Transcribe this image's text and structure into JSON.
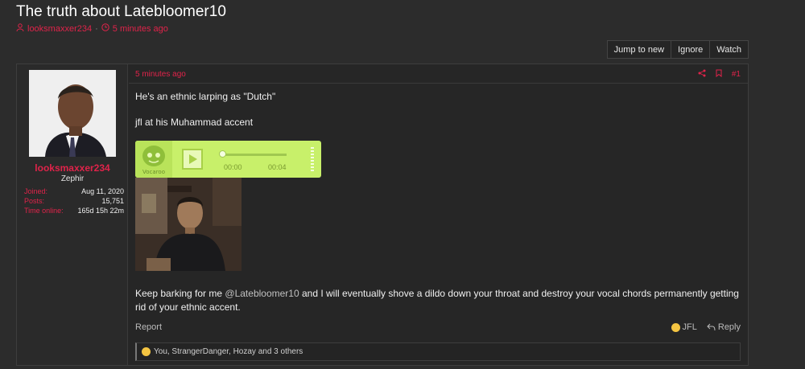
{
  "thread": {
    "title": "The truth about Latebloomer10",
    "author": "looksmaxxer234",
    "separator": "·",
    "time": "5 minutes ago"
  },
  "actions": {
    "jump_to_new": "Jump to new",
    "ignore": "Ignore",
    "watch": "Watch"
  },
  "user": {
    "name": "looksmaxxer234",
    "title": "Zephir",
    "stats": [
      {
        "label": "Joined:",
        "value": "Aug 11, 2020"
      },
      {
        "label": "Posts:",
        "value": "15,751"
      },
      {
        "label": "Time online:",
        "value": "165d 15h 22m"
      }
    ]
  },
  "post": {
    "time": "5 minutes ago",
    "number": "#1",
    "line1": "He's an ethnic larping as \"Dutch\"",
    "line2": "jfl at his Muhammad accent",
    "vocaroo": {
      "brand": "Vocaroo",
      "current_time": "00:00",
      "duration": "00:04"
    },
    "line3_before": "Keep barking for me ",
    "mention": "@Latebloomer10",
    "line3_after": " and I will eventually shove a dildo down your throat and destroy your vocal chords permanently getting rid of your ethnic accent.",
    "report": "Report",
    "jfl": "JFL",
    "reply": "Reply",
    "reactions": "You, StrangerDanger, Hozay and 3 others"
  },
  "colors": {
    "accent": "#e0234a",
    "background": "#2c2c2c",
    "vocaroo": "#c8f06a"
  }
}
